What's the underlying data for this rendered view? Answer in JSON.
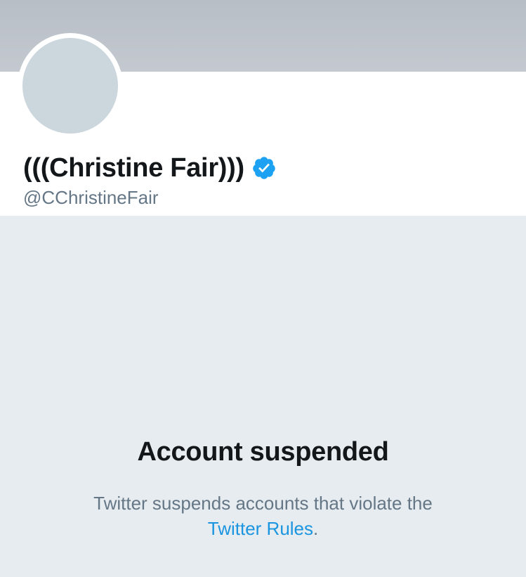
{
  "profile": {
    "display_name": "(((Christine Fair)))",
    "handle": "@CChristineFair",
    "verified_icon": "verified-badge-icon",
    "avatar": "default-avatar-placeholder"
  },
  "suspension": {
    "title": "Account suspended",
    "description_line1": "Twitter suspends accounts that violate the",
    "rules_link_label": "Twitter Rules",
    "trailing_period": "."
  },
  "colors": {
    "banner": "#c4c9d0",
    "background": "#e6ecf0",
    "avatar": "#ccd6dd",
    "primary_text": "#14171a",
    "secondary_text": "#657786",
    "link": "#1b95e0",
    "verified": "#1da1f2"
  }
}
